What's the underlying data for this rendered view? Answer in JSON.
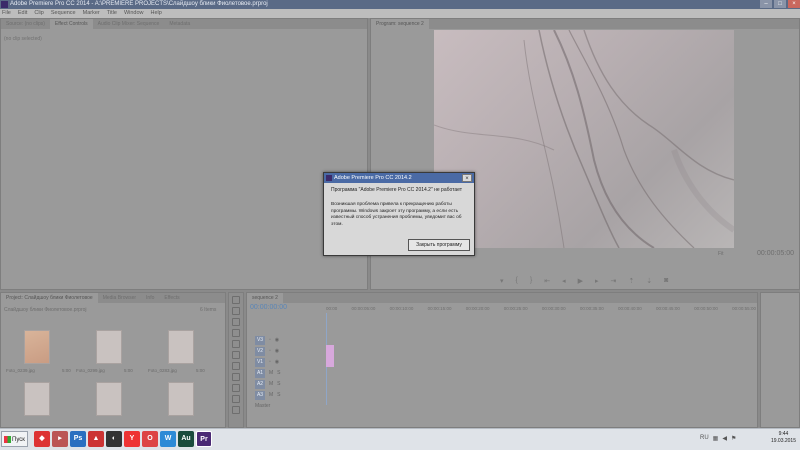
{
  "window": {
    "title": "Adobe Premiere Pro CC 2014 - A:\\PREMIERE PROJECTS\\Слайдшоу блики Фиолетовое.prproj"
  },
  "menu": [
    "File",
    "Edit",
    "Clip",
    "Sequence",
    "Marker",
    "Title",
    "Window",
    "Help"
  ],
  "source_panel": {
    "tabs": [
      "Source: (no clips)",
      "Effect Controls",
      "Audio Clip Mixer: Sequence",
      "Metadata"
    ],
    "subtitle": "(no clip selected)"
  },
  "program_panel": {
    "tab": "Program: sequence 2",
    "timecode": "00:00:05:00",
    "fit": "Fit"
  },
  "project_panel": {
    "tabs": [
      "Project: Слайдшоу блики Фиолетовое",
      "Media Browser",
      "Info",
      "Effects"
    ],
    "name": "Слайдшоу блики Фиолетовое.prproj",
    "count": "6 Items",
    "items": [
      {
        "label": "Foto_0239.jpg",
        "dur": "5:00"
      },
      {
        "label": "Foto_0299.jpg",
        "dur": "5:00"
      },
      {
        "label": "Foto_0283.jpg",
        "dur": "5:00"
      },
      {
        "label": "",
        "dur": ""
      },
      {
        "label": "",
        "dur": ""
      },
      {
        "label": "",
        "dur": ""
      }
    ]
  },
  "timeline": {
    "tab": "sequence 2",
    "timecode": "00:00:00:00",
    "ruler": [
      "00:00",
      "00:00:05:00",
      "00:00:10:00",
      "00:00:15:00",
      "00:00:20:00",
      "00:00:25:00",
      "00:00:30:00",
      "00:00:35:00",
      "00:00:40:00",
      "00:00:45:00",
      "00:00:50:00",
      "00:00:55:00"
    ],
    "tracks": [
      "V3",
      "V2",
      "V1",
      "A1",
      "A2",
      "A3",
      "Master"
    ]
  },
  "dialog": {
    "title": "Adobe Premiere Pro CC 2014.2",
    "message1": "Программа \"Adobe Premiere Pro CC 2014.2\" не работает",
    "message2": "Возникшая проблема привела к прекращению работы программы. Windows закроет эту программу, а если есть известный способ устранения проблемы, уведомит вас об этом.",
    "button": "Закрыть программу"
  },
  "taskbar": {
    "start": "Пуск",
    "time": "9:44",
    "date": "19.03.2015",
    "lang": "RU"
  }
}
